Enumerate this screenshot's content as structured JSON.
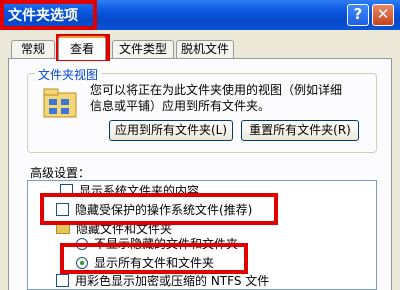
{
  "window": {
    "title": "文件夹选项",
    "help_button": "?",
    "close_button": "✕"
  },
  "tabs": [
    {
      "label": "常规"
    },
    {
      "label": "查看"
    },
    {
      "label": "文件类型"
    },
    {
      "label": "脱机文件"
    }
  ],
  "folder_views": {
    "title": "文件夹视图",
    "description_line1": "您可以将正在为此文件夹使用的视图（例如详细",
    "description_line2": "信息或平铺）应用到所有文件夹。",
    "apply_button": "应用到所有文件夹(L)",
    "reset_button": "重置所有文件夹(R)"
  },
  "advanced": {
    "label": "高级设置：",
    "items": [
      {
        "text": "显示系统文件夹的内容",
        "type": "checkbox",
        "checked": false
      },
      {
        "text": "隐藏受保护的操作系统文件(推荐)",
        "type": "checkbox",
        "checked": false
      },
      {
        "text": "隐藏文件和文件夹",
        "type": "folder"
      },
      {
        "text": "不显示隐藏的文件和文件夹",
        "type": "radio",
        "selected": false
      },
      {
        "text": "显示所有文件和文件夹",
        "type": "radio",
        "selected": true
      },
      {
        "text": "用彩色显示加密或压缩的 NTFS 文件",
        "type": "checkbox",
        "checked": true
      }
    ]
  },
  "colors": {
    "highlight": "#e00000",
    "titlebar": "#0548c8",
    "group_title": "#0046d5"
  }
}
